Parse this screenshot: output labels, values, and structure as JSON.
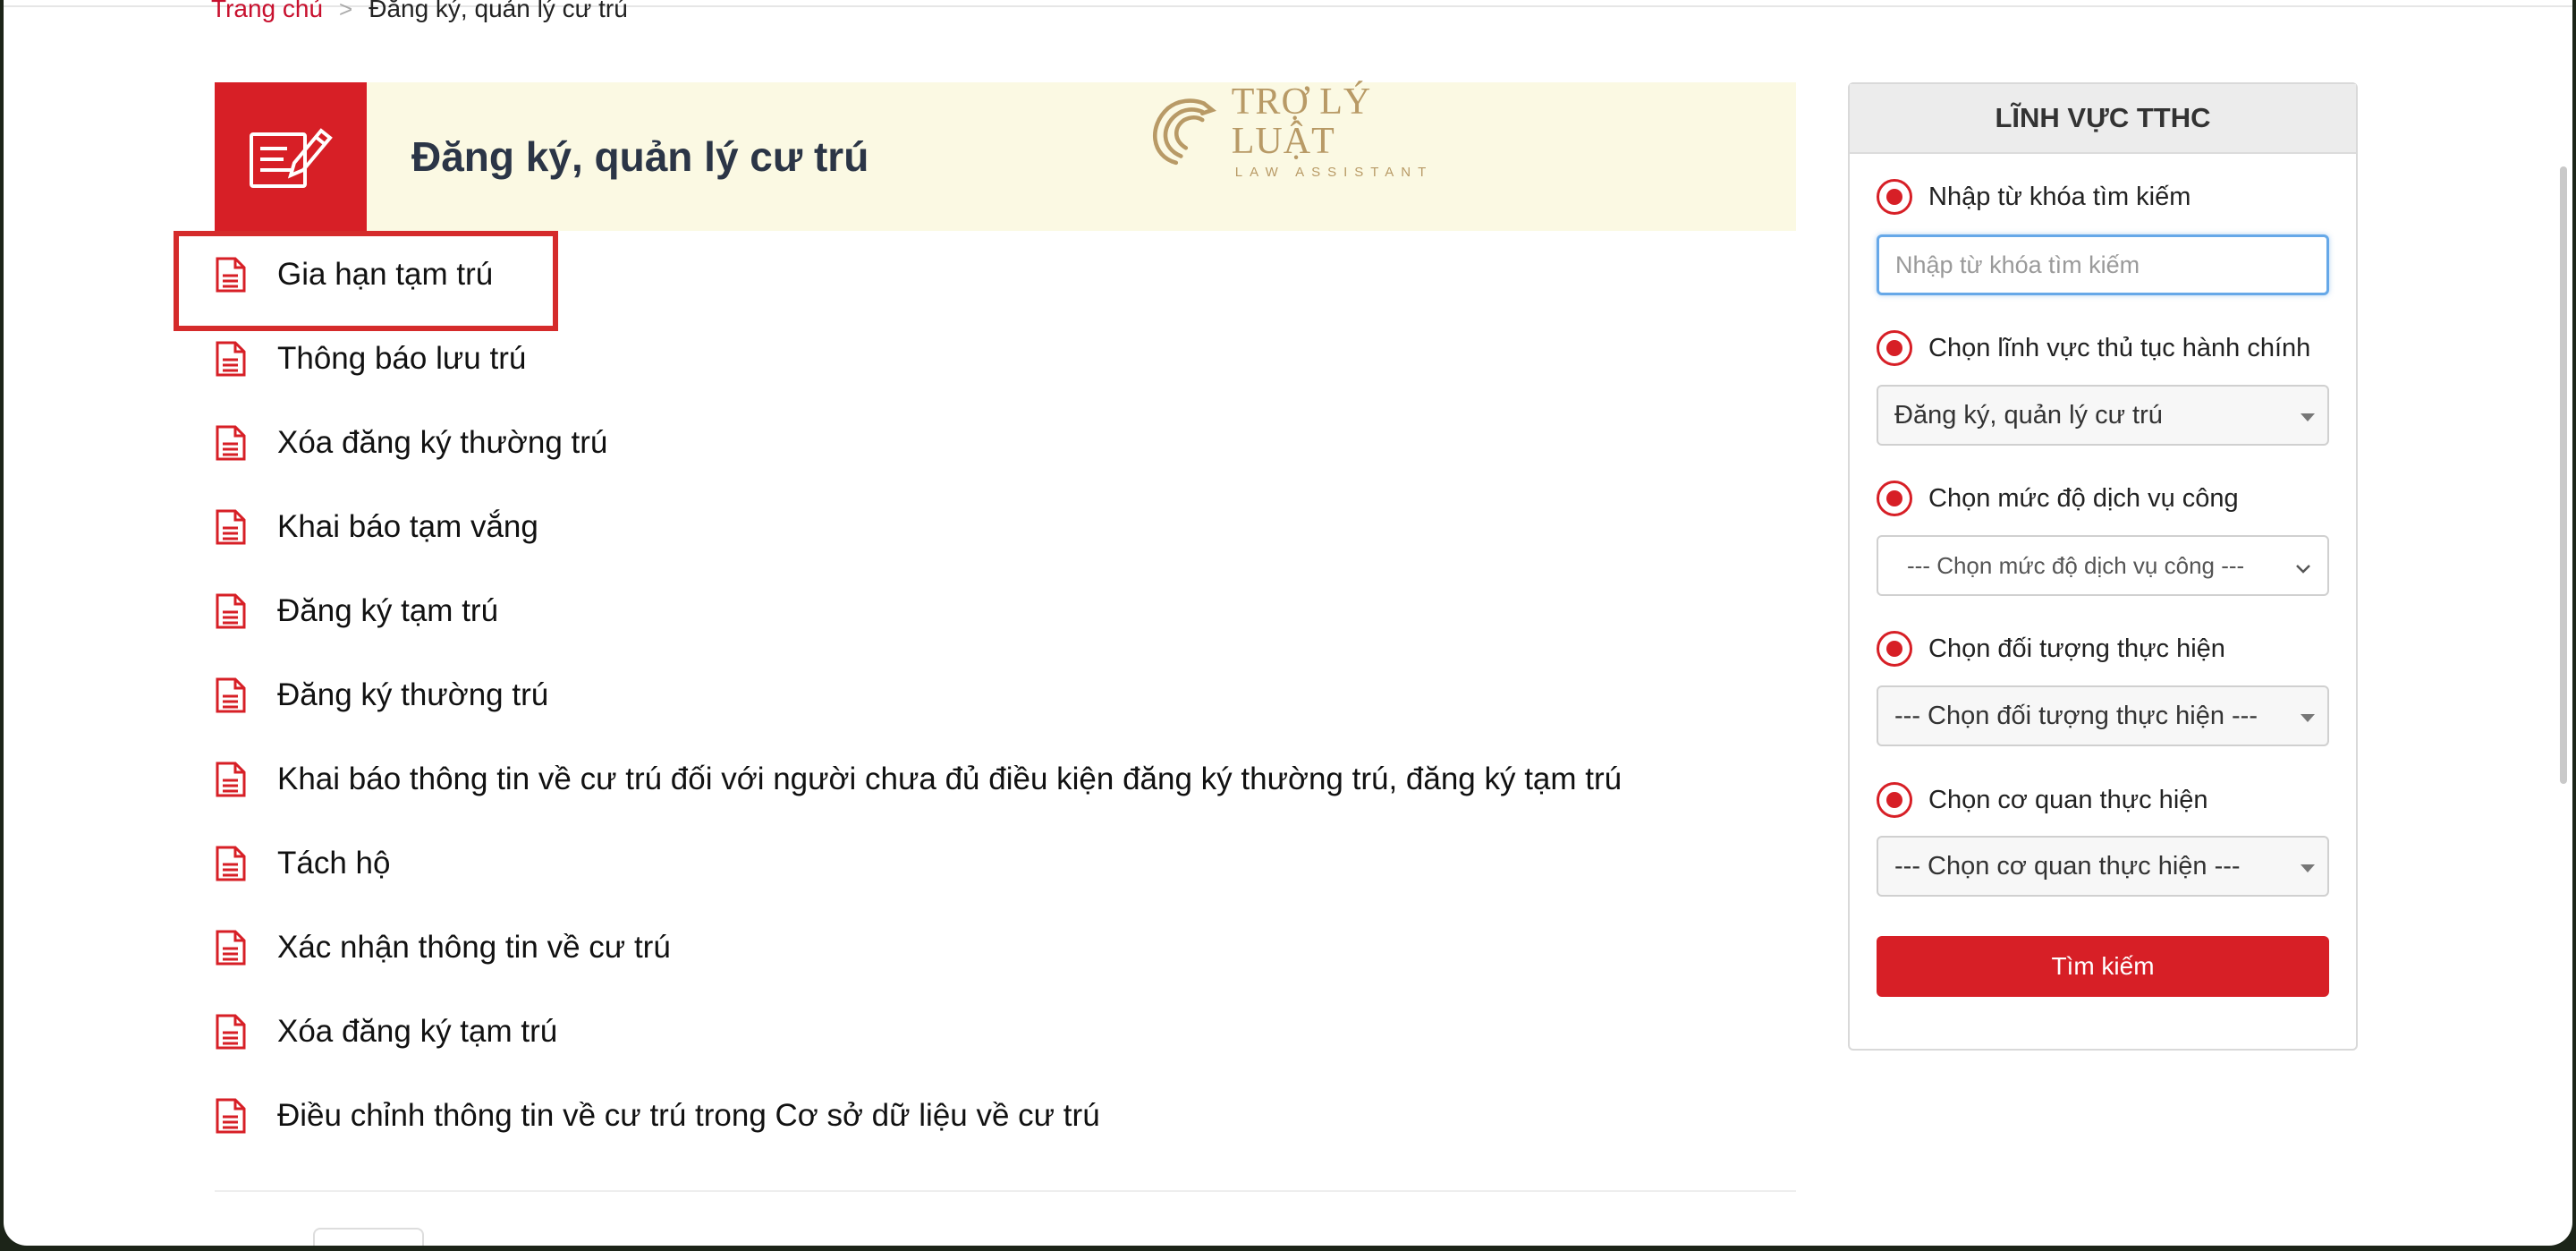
{
  "breadcrumb": {
    "home": "Trang chủ",
    "separator": ">",
    "current": "Đăng ký, quản lý cư trú"
  },
  "banner": {
    "title": "Đăng ký, quản lý cư trú",
    "icon": "document-edit-icon",
    "logo_name": "TRỢ LÝ LUẬT",
    "logo_sub": "LAW ASSISTANT",
    "background": "#fbf9e3",
    "accent": "#d71f26"
  },
  "procedures": [
    {
      "label": "Gia hạn tạm trú"
    },
    {
      "label": "Thông báo lưu trú"
    },
    {
      "label": "Xóa đăng ký thường trú"
    },
    {
      "label": "Khai báo tạm vắng"
    },
    {
      "label": "Đăng ký tạm trú"
    },
    {
      "label": "Đăng ký thường trú"
    },
    {
      "label": "Khai báo thông tin về cư trú đối với người chưa đủ điều kiện đăng ký thường trú, đăng ký tạm trú"
    },
    {
      "label": "Tách hộ"
    },
    {
      "label": "Xác nhận thông tin về cư trú"
    },
    {
      "label": "Xóa đăng ký tạm trú"
    },
    {
      "label": "Điều chỉnh thông tin về cư trú trong Cơ sở dữ liệu về cư trú"
    }
  ],
  "sidebar": {
    "title": "LĨNH VỰC TTHC",
    "keyword_label": "Nhập từ khóa tìm kiếm",
    "keyword_placeholder": "Nhập từ khóa tìm kiếm",
    "field_label": "Chọn lĩnh vực thủ tục hành chính",
    "field_value": "Đăng ký, quản lý cư trú",
    "level_label": "Chọn mức độ dịch vụ công",
    "level_value": "--- Chọn mức độ dịch vụ công ---",
    "subject_label": "Chọn đối tượng thực hiện",
    "subject_value": "--- Chọn đối tượng thực hiện ---",
    "agency_label": "Chọn cơ quan thực hiện",
    "agency_value": "--- Chọn cơ quan thực hiện ---",
    "search_button": "Tìm kiếm"
  }
}
